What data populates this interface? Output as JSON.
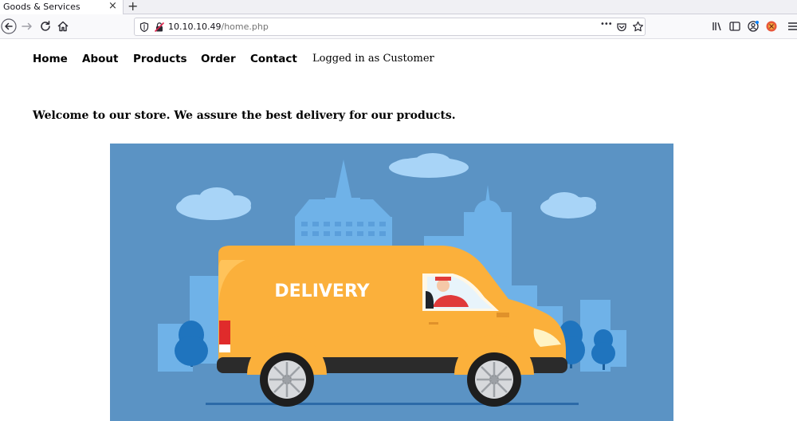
{
  "browser": {
    "tab_title": "Goods & Services",
    "tab_close": "×",
    "new_tab": "+",
    "url_host": "10.10.10.49",
    "url_path": "/home.php",
    "more_label": "•••"
  },
  "site": {
    "nav": [
      {
        "label": "Home"
      },
      {
        "label": "About"
      },
      {
        "label": "Products"
      },
      {
        "label": "Order"
      },
      {
        "label": "Contact"
      }
    ],
    "status": "Logged in as Customer",
    "welcome": "Welcome to our store. We assure the best delivery for our products.",
    "hero": {
      "van_text": "DELIVERY",
      "colors": {
        "sky": "#5b93c4",
        "buildings": "#6fb2e8",
        "van": "#fbb03b",
        "trees": "#1f74be"
      }
    }
  },
  "icons": [
    "back-icon",
    "forward-icon",
    "reload-icon",
    "home-icon",
    "shield-icon",
    "insecure-lock-icon",
    "page-actions-icon",
    "pocket-icon",
    "bookmark-star-icon",
    "library-icon",
    "sidebar-icon",
    "account-icon",
    "extension-icon",
    "menu-icon"
  ]
}
